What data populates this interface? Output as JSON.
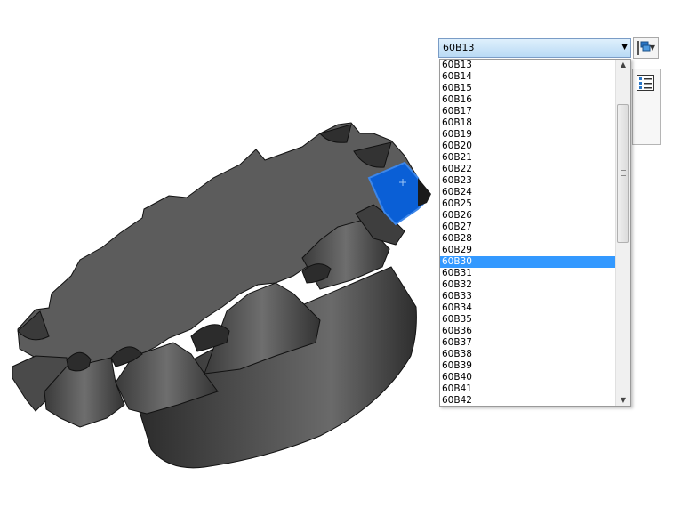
{
  "combo": {
    "selected": "60B13",
    "arrow_icon": "chevron-down-icon"
  },
  "toolbar": {
    "button_icon": "configuration-icon",
    "panel_icon": "property-list-icon"
  },
  "list": {
    "items": [
      "60B13",
      "60B14",
      "60B15",
      "60B16",
      "60B17",
      "60B18",
      "60B19",
      "60B20",
      "60B21",
      "60B22",
      "60B23",
      "60B24",
      "60B25",
      "60B26",
      "60B27",
      "60B28",
      "60B29",
      "60B30",
      "60B31",
      "60B32",
      "60B33",
      "60B34",
      "60B35",
      "60B36",
      "60B37",
      "60B38",
      "60B39",
      "60B40",
      "60B41",
      "60B42"
    ],
    "highlighted": "60B30"
  },
  "colors": {
    "highlight": "#3399ff",
    "selected_face": "#0a5fd6",
    "gear": "#5a5a5a"
  }
}
